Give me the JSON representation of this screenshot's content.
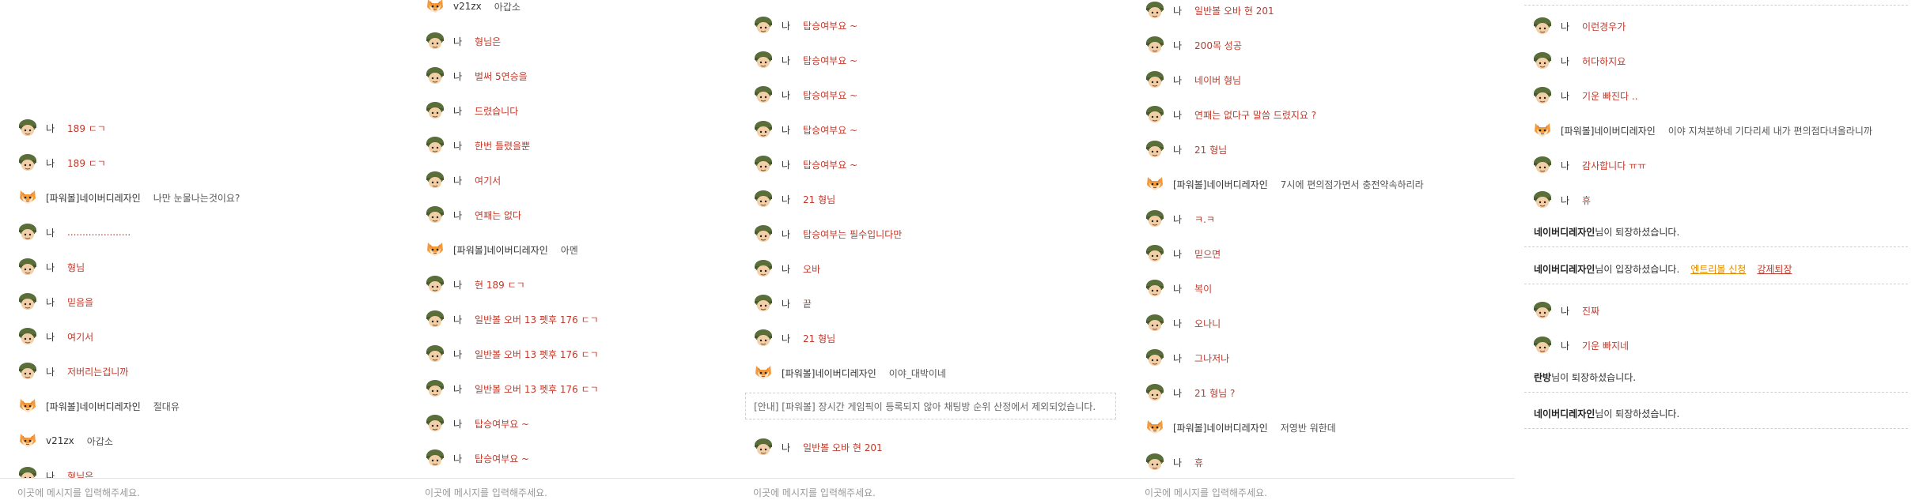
{
  "common": {
    "placeholder": "이곳에 메시지를 입력해주세요."
  },
  "panels": [
    {
      "messages": [
        {
          "nick": "나",
          "text": "189 ㄷㄱ",
          "me": true
        },
        {
          "nick": "나",
          "text": "189 ㄷㄱ",
          "me": true
        },
        {
          "nick": "[파워볼]네이버디레자인",
          "text": "나만 눈물나는것이요?",
          "me": false
        },
        {
          "nick": "나",
          "text": ".....................",
          "me": true
        },
        {
          "nick": "나",
          "text": "형님",
          "me": true
        },
        {
          "nick": "나",
          "text": "믿음을",
          "me": true
        },
        {
          "nick": "나",
          "text": "여기서",
          "me": true
        },
        {
          "nick": "나",
          "text": "저버리는겁니까",
          "me": true
        },
        {
          "nick": "[파워볼]네이버디레자인",
          "text": "절대유",
          "me": false
        },
        {
          "nick": "v21zx",
          "text": "아갑소",
          "me": false
        },
        {
          "nick": "나",
          "text": "형님은",
          "me": true
        }
      ]
    },
    {
      "messages": [
        {
          "nick": "v21zx",
          "text": "아갑소",
          "me": false
        },
        {
          "nick": "나",
          "text": "형님은",
          "me": true
        },
        {
          "nick": "나",
          "text": "벌써 5연승을",
          "me": true
        },
        {
          "nick": "나",
          "text": "드렸습니다",
          "me": true
        },
        {
          "nick": "나",
          "text": "한번 틀렸을뿐",
          "me": true
        },
        {
          "nick": "나",
          "text": "여기서",
          "me": true
        },
        {
          "nick": "나",
          "text": "연패는 없다",
          "me": true
        },
        {
          "nick": "[파워볼]네이버디레자인",
          "text": "아멘",
          "me": false
        },
        {
          "nick": "나",
          "text": "현 189 ㄷㄱ",
          "me": true
        },
        {
          "nick": "나",
          "text": "일반볼 오버 13 펫후 176 ㄷㄱ",
          "me": true
        },
        {
          "nick": "나",
          "text": "일반볼 오버 13 펫후 176 ㄷㄱ",
          "me": true
        },
        {
          "nick": "나",
          "text": "일반볼 오버 13 펫후 176 ㄷㄱ",
          "me": true
        },
        {
          "nick": "나",
          "text": "탑승여부요 ~",
          "me": true
        },
        {
          "nick": "나",
          "text": "탑승여부요 ~",
          "me": true
        }
      ]
    },
    {
      "messages": [
        {
          "nick": "나",
          "text": "탑승여부요 ~",
          "me": true
        },
        {
          "nick": "나",
          "text": "탑승여부요 ~",
          "me": true
        },
        {
          "nick": "나",
          "text": "탑승여부요 ~",
          "me": true
        },
        {
          "nick": "나",
          "text": "탑승여부요 ~",
          "me": true
        },
        {
          "nick": "나",
          "text": "탑승여부요 ~",
          "me": true
        },
        {
          "nick": "나",
          "text": "21 형님",
          "me": true
        },
        {
          "nick": "나",
          "text": "탑승여부는 필수입니다만",
          "me": true
        },
        {
          "nick": "나",
          "text": "오바",
          "me": true
        },
        {
          "nick": "나",
          "text": "끝",
          "me": true
        },
        {
          "nick": "나",
          "text": "21 형님",
          "me": true
        },
        {
          "nick": "[파워볼]네이버디레자인",
          "text": "이야_대박이네",
          "me": false
        }
      ],
      "notice": "[안내] [파워볼] 장시간 게임픽이 등록되지 않아 채팅방 순위 산정에서 제외되었습니다.",
      "after": [
        {
          "nick": "나",
          "text": "일반볼 오바 현 201",
          "me": true
        }
      ]
    },
    {
      "messages": [
        {
          "nick": "나",
          "text": "일반볼 오바 현 201",
          "me": true
        },
        {
          "nick": "나",
          "text": "200목 성공",
          "me": true
        },
        {
          "nick": "나",
          "text": "네이버 형님",
          "me": true
        },
        {
          "nick": "나",
          "text": "연패는 없다구 말씀 드렸지요 ?",
          "me": true
        },
        {
          "nick": "나",
          "text": "21 형님",
          "me": true
        },
        {
          "nick": "[파워볼]네이버디레자인",
          "text": "7시에 편의점가면서 충전약속하리라",
          "me": false
        },
        {
          "nick": "나",
          "text": "ㅋ.ㅋ",
          "me": true
        },
        {
          "nick": "나",
          "text": "믿으면",
          "me": true
        },
        {
          "nick": "나",
          "text": "복이",
          "me": true
        },
        {
          "nick": "나",
          "text": "오나니",
          "me": true
        },
        {
          "nick": "나",
          "text": "그나저나",
          "me": true
        },
        {
          "nick": "나",
          "text": "21 형님 ?",
          "me": true
        },
        {
          "nick": "[파워볼]네이버디레자인",
          "text": "저영반 워한데",
          "me": false
        },
        {
          "nick": "나",
          "text": "휴",
          "me": true
        }
      ]
    },
    {
      "messages": [
        {
          "nick": "나",
          "text": "이런경우가",
          "me": true
        },
        {
          "nick": "나",
          "text": "허다하지요",
          "me": true
        },
        {
          "nick": "나",
          "text": "기운 빠진다 ..",
          "me": true
        },
        {
          "nick": "[파워볼]네이버디레자인",
          "text": "이야 지쳐분하네 기다리세 내가 편의점다녀올라니까",
          "me": false
        },
        {
          "nick": "나",
          "text": "감사합니다 ㅠㅠ",
          "me": true
        },
        {
          "nick": "나",
          "text": "휴",
          "me": true
        }
      ],
      "sys1": {
        "name": "네이버디레자인",
        "suffix": "님이 퇴장하셨습니다."
      },
      "sys2": {
        "name": "네이버디레자인",
        "suffix": "님이 입장하셨습니다.",
        "link1": "엔트리볼 신청",
        "link2": "강제퇴장"
      },
      "mid": [
        {
          "nick": "나",
          "text": "진짜",
          "me": true
        },
        {
          "nick": "나",
          "text": "기운 빠지네",
          "me": true
        }
      ],
      "sys3": {
        "name": "란방",
        "suffix": "님이 퇴장하셨습니다."
      },
      "sys4": {
        "name": "네이버디레자인",
        "suffix": "님이 퇴장하셨습니다."
      }
    }
  ]
}
